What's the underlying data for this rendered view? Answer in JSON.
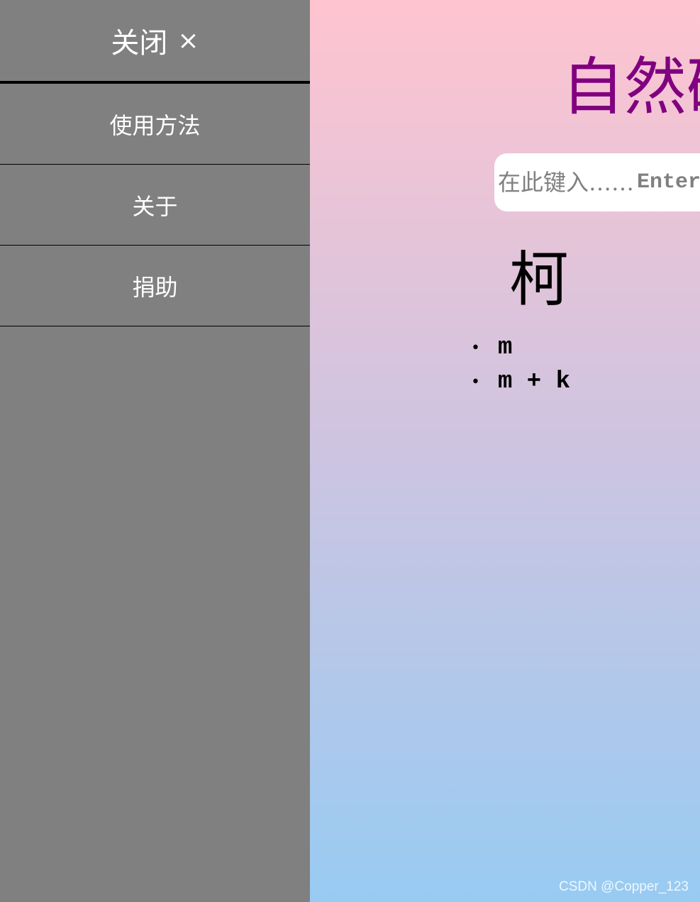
{
  "sidebar": {
    "close": {
      "label": "关闭",
      "icon": "×"
    },
    "items": [
      {
        "label": "使用方法"
      },
      {
        "label": "关于"
      },
      {
        "label": "捐助"
      }
    ]
  },
  "main": {
    "title": "自然码",
    "search": {
      "placeholder": "在此键入……",
      "value": "",
      "enter_label": "Enter"
    },
    "result": {
      "char": "柯",
      "codes": [
        "m",
        "m + k"
      ]
    }
  },
  "watermark": "CSDN @Copper_123",
  "colors": {
    "sidebar_bg": "#808080",
    "title": "#800080",
    "gradient_top": "#ffc4d0",
    "gradient_bottom": "#98cbf2"
  }
}
